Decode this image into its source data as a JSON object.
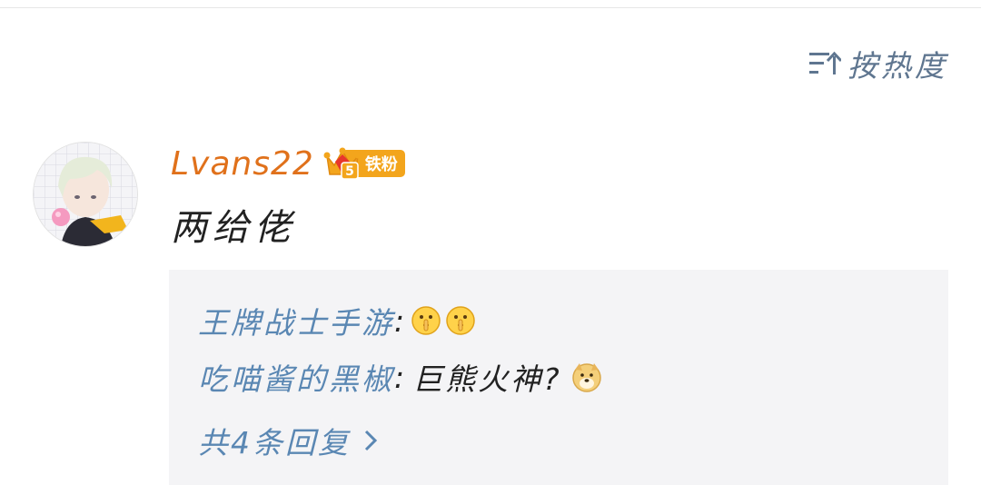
{
  "sort": {
    "label": "按热度",
    "icon": "sort-up-icon"
  },
  "comment": {
    "author": "Lvans22",
    "badge": {
      "level": "5",
      "label": "铁粉",
      "icon": "crown-icon",
      "color": "#f3a51c"
    },
    "text": "两给佬",
    "avatar": "anime-boy-avatar"
  },
  "replies": [
    {
      "user": "王牌战士手游",
      "separator": ":",
      "text": "",
      "emojis": [
        "shush-emoji",
        "shush-emoji"
      ]
    },
    {
      "user": "吃喵酱的黑椒",
      "separator": ":",
      "text": "巨熊火神?",
      "emojis": [
        "doge-emoji"
      ]
    }
  ],
  "more_replies": {
    "label": "共4条回复",
    "icon": "chevron-right-icon"
  },
  "colors": {
    "author": "#e0711b",
    "link": "#5a87b3",
    "sort": "#5f7690",
    "reply_bg": "#f4f4f6"
  }
}
